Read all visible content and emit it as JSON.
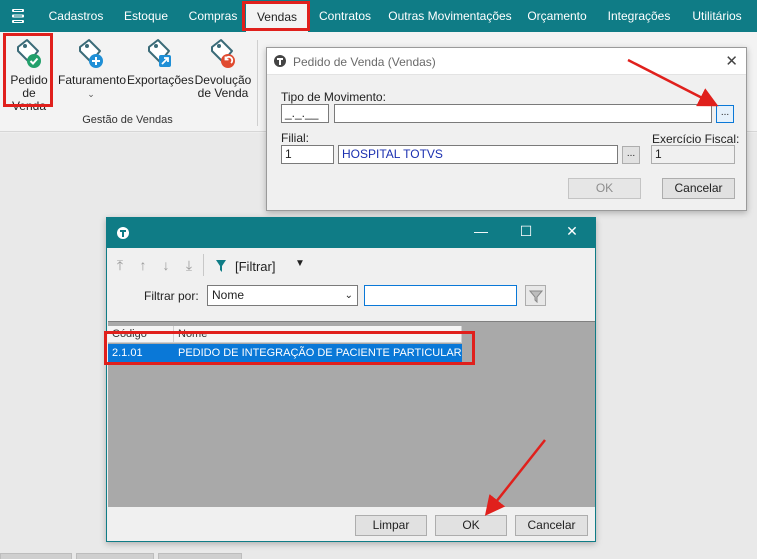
{
  "menubar": {
    "tabs": [
      {
        "label": "Cadastros"
      },
      {
        "label": "Estoque"
      },
      {
        "label": "Compras"
      },
      {
        "label": "Vendas"
      },
      {
        "label": "Contratos"
      },
      {
        "label": "Outras Movimentações"
      },
      {
        "label": "Orçamento"
      },
      {
        "label": "Integrações"
      },
      {
        "label": "Utilitários"
      }
    ],
    "active_tab": "Vendas"
  },
  "ribbon": {
    "buttons": [
      {
        "label_line1": "Pedido",
        "label_line2": "de Venda",
        "icon": "tag-check-icon"
      },
      {
        "label_line1": "Faturamento",
        "label_line2": "",
        "icon": "tag-plus-icon"
      },
      {
        "label_line1": "Exportações",
        "label_line2": "",
        "icon": "tag-export-icon"
      },
      {
        "label_line1": "Devolução",
        "label_line2": "de Venda",
        "icon": "tag-return-icon"
      }
    ],
    "group_label": "Gestão de Vendas"
  },
  "dialog_pedido": {
    "title": "Pedido de Venda (Vendas)",
    "tipo_movimento_label": "Tipo de Movimento:",
    "tipo_movimento_code": "_._.__",
    "tipo_movimento_desc": "",
    "filial_label": "Filial:",
    "filial_code": "1",
    "filial_name": "HOSPITAL TOTVS",
    "exercicio_label": "Exercício Fiscal:",
    "exercicio_value": "1",
    "ok_label": "OK",
    "cancel_label": "Cancelar",
    "ellipsis": "..."
  },
  "dialog_lookup": {
    "filter_button_label": "[Filtrar]",
    "filter_by_label": "Filtrar por:",
    "filter_by_value": "Nome",
    "filter_text": "",
    "grid": {
      "columns": [
        "Código",
        "Nome"
      ],
      "rows": [
        {
          "codigo": "2.1.01",
          "nome": "PEDIDO DE INTEGRAÇÃO  DE PACIENTE PARTICULAR"
        }
      ]
    },
    "clear_label": "Limpar",
    "ok_label": "OK",
    "cancel_label": "Cancelar"
  },
  "colors": {
    "brand_teal": "#0f7c86",
    "annotation_red": "#e0201c",
    "selection_blue": "#0a78d7"
  }
}
